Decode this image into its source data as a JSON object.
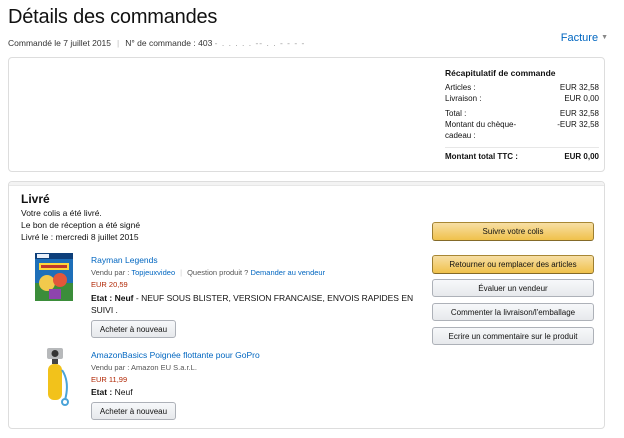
{
  "header": {
    "title": "Détails des commandes",
    "ordered_on": "Commandé le 7 juillet 2015",
    "order_number_label": "N° de commande :",
    "order_number_visible": "403",
    "order_number_masked": "- . . . . . -- . . - - - -",
    "invoice_label": "Facture"
  },
  "summary": {
    "title": "Récapitulatif de commande",
    "rows": [
      {
        "label": "Articles :",
        "value": "EUR 32,58"
      },
      {
        "label": "Livraison :",
        "value": "EUR 0,00"
      },
      {
        "label": "Total :",
        "value": "EUR 32,58"
      },
      {
        "label": "Montant du chèque-cadeau :",
        "value": "-EUR 32,58"
      }
    ],
    "grand_total_label": "Montant total TTC :",
    "grand_total_value": "EUR 0,00"
  },
  "shipment": {
    "status": "Livré",
    "lines": [
      "Votre colis a été livré.",
      "Le bon de réception a été signé",
      "Livré le : mercredi 8 juillet 2015"
    ]
  },
  "items": [
    {
      "title": "Rayman Legends",
      "sold_by_label": "Vendu par :",
      "seller": "Topjeuxvideo",
      "question_label": "Question produit ?",
      "contact_seller": "Demander au vendeur",
      "price": "EUR 20,59",
      "condition_label": "Etat :",
      "condition_value": "Neuf",
      "condition_note": "- NEUF SOUS BLISTER, VERSION FRANCAISE, ENVOIS RAPIDES EN SUIVI .",
      "buy_again": "Acheter à nouveau"
    },
    {
      "title": "AmazonBasics Poignée flottante pour GoPro",
      "sold_by_line": "Vendu par : Amazon EU S.a.r.L.",
      "price": "EUR 11,99",
      "condition_label": "Etat :",
      "condition_value": "Neuf",
      "buy_again": "Acheter à nouveau"
    }
  ],
  "actions": {
    "track": "Suivre votre colis",
    "return": "Retourner ou remplacer des articles",
    "rate_seller": "Évaluer un vendeur",
    "delivery_feedback": "Commenter la livraison/l'emballage",
    "review_product": "Ecrire un commentaire sur le produit"
  },
  "colors": {
    "link": "#0066c0",
    "price": "#b12704",
    "primary_button": "#f0c14b"
  }
}
